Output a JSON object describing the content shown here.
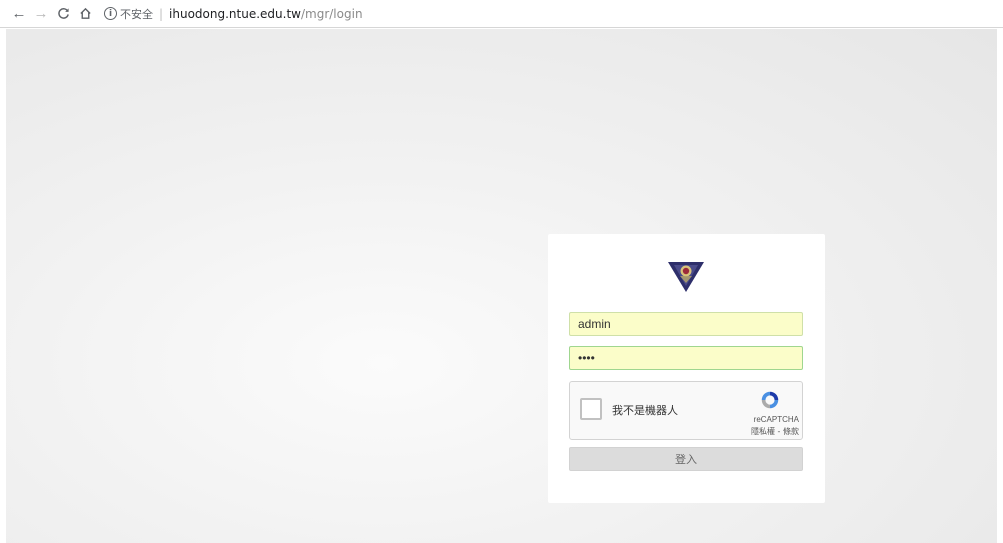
{
  "browser": {
    "back_icon": "back-arrow-icon",
    "forward_icon": "forward-arrow-icon",
    "reload_icon": "reload-icon",
    "home_icon": "home-icon",
    "security_label": "不安全",
    "url_host": "ihuodong.ntue.edu.tw",
    "url_path": "/mgr/login"
  },
  "login": {
    "username_value": "admin",
    "password_value": "••••",
    "captcha_label": "我不是機器人",
    "captcha_brand": "reCAPTCHA",
    "captcha_links": "隱私權 - 條款",
    "submit_label": "登入"
  },
  "colors": {
    "autofill_bg": "#fbfdc9",
    "button_bg": "#dcdcdc",
    "logo_purple": "#2e2f6b",
    "logo_red": "#9c2a3a"
  }
}
